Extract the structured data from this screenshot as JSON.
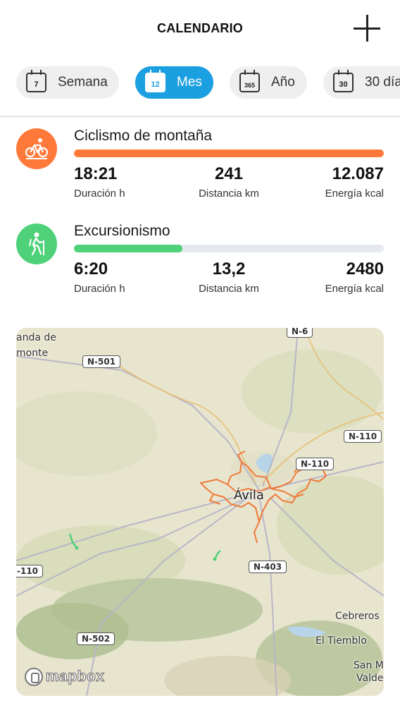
{
  "header": {
    "title": "CALENDARIO",
    "add_icon": "plus-icon"
  },
  "tabs": [
    {
      "icon_text": "7",
      "label": "Semana",
      "active": false
    },
    {
      "icon_text": "12",
      "label": "Mes",
      "active": true
    },
    {
      "icon_text": "365",
      "label": "Año",
      "active": false
    },
    {
      "icon_text": "30",
      "label": "30 día",
      "active": false
    }
  ],
  "colors": {
    "accent": "#1a9fe0",
    "cycling": "#ff7a3a",
    "hiking": "#4fd17a"
  },
  "activities": [
    {
      "icon": "mountain-bike-icon",
      "name": "Ciclismo de montaña",
      "progress": 1.0,
      "duration": {
        "value": "18:21",
        "label": "Duración h"
      },
      "distance": {
        "value": "241",
        "label": "Distancia km"
      },
      "energy": {
        "value": "12.087",
        "label": "Energía kcal"
      }
    },
    {
      "icon": "hiking-icon",
      "name": "Excursionismo",
      "progress": 0.35,
      "duration": {
        "value": "6:20",
        "label": "Duración h"
      },
      "distance": {
        "value": "13,2",
        "label": "Distancia km"
      },
      "energy": {
        "value": "2480",
        "label": "Energía kcal"
      }
    }
  ],
  "map": {
    "city": "Ávila",
    "places": [
      "anda de",
      "montе",
      "Cebreros",
      "El Tiemblo",
      "San M",
      "Valde"
    ],
    "roads": [
      "N-6",
      "N-501",
      "N-110",
      "N-110",
      "-110",
      "N-403",
      "N-502"
    ],
    "attribution": "mapbox"
  }
}
